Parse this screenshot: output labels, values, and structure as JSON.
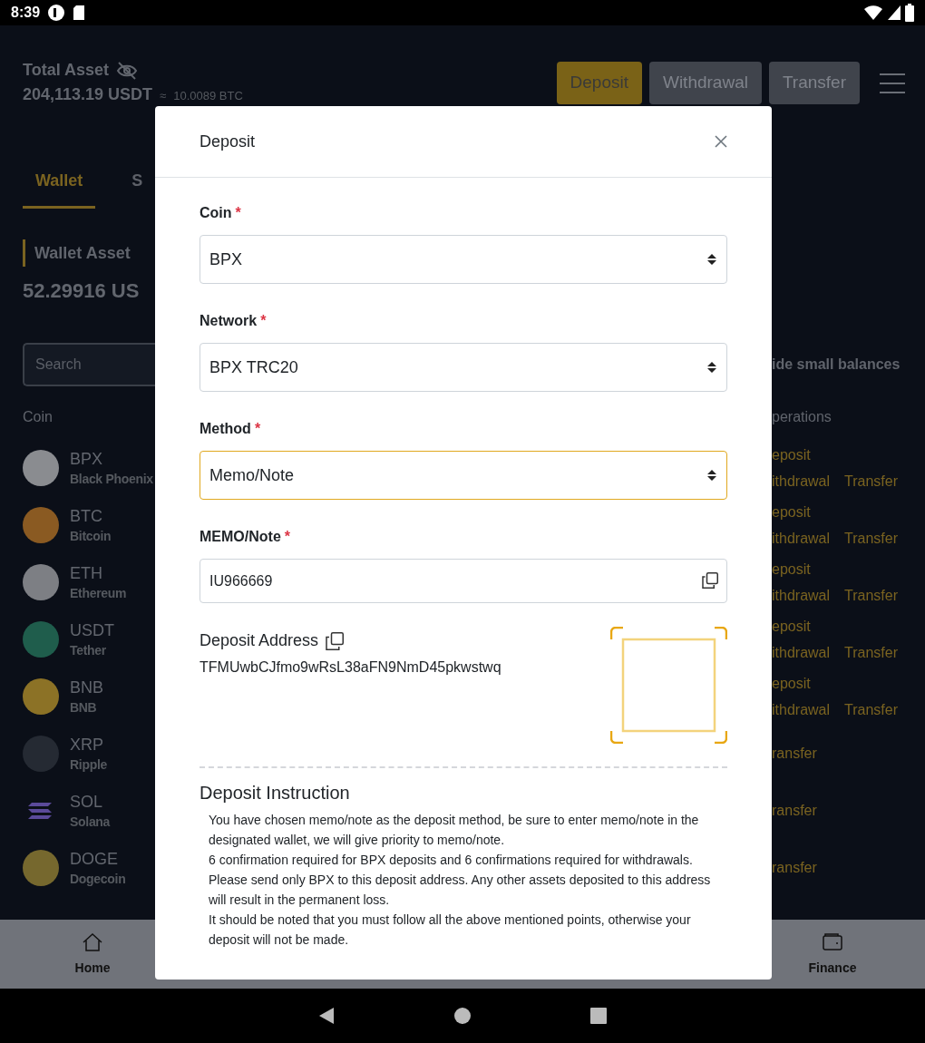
{
  "status_bar": {
    "time": "8:39"
  },
  "header": {
    "title": "Total Asset",
    "total": "204,113.19 USDT",
    "approx": "≈",
    "btc": "10.0089 BTC",
    "buttons": [
      {
        "label": "Deposit",
        "selected": true
      },
      {
        "label": "Withdrawal",
        "selected": false
      },
      {
        "label": "Transfer",
        "selected": false
      }
    ]
  },
  "tabs": [
    {
      "label": "Wallet",
      "selected": true
    },
    {
      "label": "S",
      "selected": false
    }
  ],
  "wallet": {
    "title": "Wallet Asset",
    "amount": "52.29916 US",
    "search_placeholder": "Search",
    "hide_label": "ide small balances",
    "coin_header": "Coin",
    "operations_header": "perations"
  },
  "coins": [
    {
      "symbol": "BPX",
      "name": "Black Phoenix",
      "kind": "circle",
      "color": "#8a8c90",
      "operations": [
        [
          "eposit"
        ],
        [
          "ithdrawal",
          "Transfer"
        ]
      ]
    },
    {
      "symbol": "BTC",
      "name": "Bitcoin",
      "kind": "circle",
      "color": "#8a5a22",
      "operations": [
        [
          "eposit"
        ],
        [
          "ithdrawal",
          "Transfer"
        ]
      ]
    },
    {
      "symbol": "ETH",
      "name": "Ethereum",
      "kind": "circle",
      "color": "#7d7f84",
      "operations": [
        [
          "eposit"
        ],
        [
          "ithdrawal",
          "Transfer"
        ]
      ]
    },
    {
      "symbol": "USDT",
      "name": "Tether",
      "kind": "circle",
      "color": "#1f5d4c",
      "operations": [
        [
          "eposit"
        ],
        [
          "ithdrawal",
          "Transfer"
        ]
      ]
    },
    {
      "symbol": "BNB",
      "name": "BNB",
      "kind": "circle",
      "color": "#8c7226",
      "operations": [
        [
          "eposit"
        ],
        [
          "ithdrawal",
          "Transfer"
        ]
      ]
    },
    {
      "symbol": "XRP",
      "name": "Ripple",
      "kind": "circle",
      "color": "#252a33",
      "operations": [
        [
          "ransfer"
        ]
      ]
    },
    {
      "symbol": "SOL",
      "name": "Solana",
      "kind": "stripes",
      "color": "#5b4a9a",
      "operations": [
        [
          "ransfer"
        ]
      ]
    },
    {
      "symbol": "DOGE",
      "name": "Dogecoin",
      "kind": "circle",
      "color": "#76682e",
      "operations": [
        [
          "ransfer"
        ]
      ]
    }
  ],
  "bottom_nav": [
    {
      "label": "Home",
      "kind": "home"
    },
    {
      "label": "Finance",
      "kind": "wallet"
    }
  ],
  "modal": {
    "title": "Deposit",
    "fields": [
      {
        "label": "Coin",
        "required_mark": "*",
        "kind": "select",
        "value": "BPX",
        "focused": false
      },
      {
        "label": "Network",
        "required_mark": "*",
        "kind": "select",
        "value": "BPX TRC20",
        "focused": false
      },
      {
        "label": "Method",
        "required_mark": "*",
        "kind": "select",
        "value": "Memo/Note",
        "focused": true
      },
      {
        "label": "MEMO/Note",
        "required_mark": "*",
        "kind": "copy",
        "value": "IU966669",
        "focused": false
      }
    ],
    "address": {
      "label": "Deposit Address",
      "value": "TFMUwbCJfmo9wRsL38aFN9NmD45pkwstwq"
    },
    "instruction": {
      "title": "Deposit Instruction",
      "paragraphs": [
        "You have chosen memo/note as the deposit method, be sure to enter memo/note in the designated wallet, we will give priority to memo/note.",
        "6 confirmation required for BPX deposits and 6 confirmations required for withdrawals.",
        "Please send only BPX to this deposit address. Any other assets deposited to this address will result in the permanent loss.",
        "It should be noted that you must follow all the above mentioned points, otherwise your deposit will not be made."
      ]
    }
  }
}
